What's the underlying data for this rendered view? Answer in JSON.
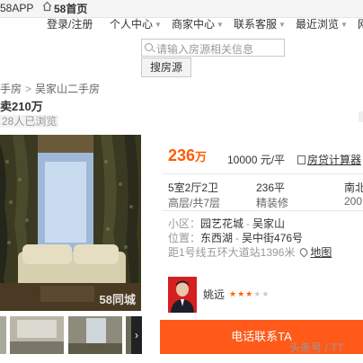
{
  "topbar": {
    "app_label": "58APP",
    "home_label": "58首页"
  },
  "nav": {
    "items": [
      {
        "label": "登录/注册"
      },
      {
        "label": "个人中心"
      },
      {
        "label": "商家中心"
      },
      {
        "label": "联系客服"
      },
      {
        "label": "最近浏览"
      },
      {
        "label": "网"
      }
    ]
  },
  "search": {
    "placeholder": "请输入房源相关信息",
    "button_label": "搜房源"
  },
  "breadcrumb": {
    "items": [
      "手房",
      "吴家山二手房"
    ],
    "separator": ">"
  },
  "listing": {
    "title": "卖210万",
    "views": "28人已浏览",
    "watermark": "58同城",
    "price_value": "236",
    "price_unit": "万",
    "unit_price": "10000 元/平",
    "calculator_label": "房贷计算器",
    "specs": {
      "layout": "5室2厅2卫",
      "floor": "高层/共7层",
      "area": "236平",
      "decoration": "精装修",
      "orientation": "南北",
      "year": "200"
    },
    "community_label": "小区：",
    "community": "园艺花城",
    "community_sep": "-",
    "community_area": "吴家山",
    "location_label": "位置：",
    "district": "东西湖",
    "location_sep": "-",
    "street": "吴中街476号",
    "distance": "距1号线五环大道站1396米",
    "map_label": "地图"
  },
  "agent": {
    "name": "姚远",
    "rating": 3,
    "rating_max": 5
  },
  "call_button_label": "电话联系TA",
  "source_watermark": "头条号 / TT",
  "thumbnail_next": "›",
  "colors": {
    "accent": "#ff5a00",
    "call_button": "#ff5a19",
    "star_on": "#ff6600"
  }
}
